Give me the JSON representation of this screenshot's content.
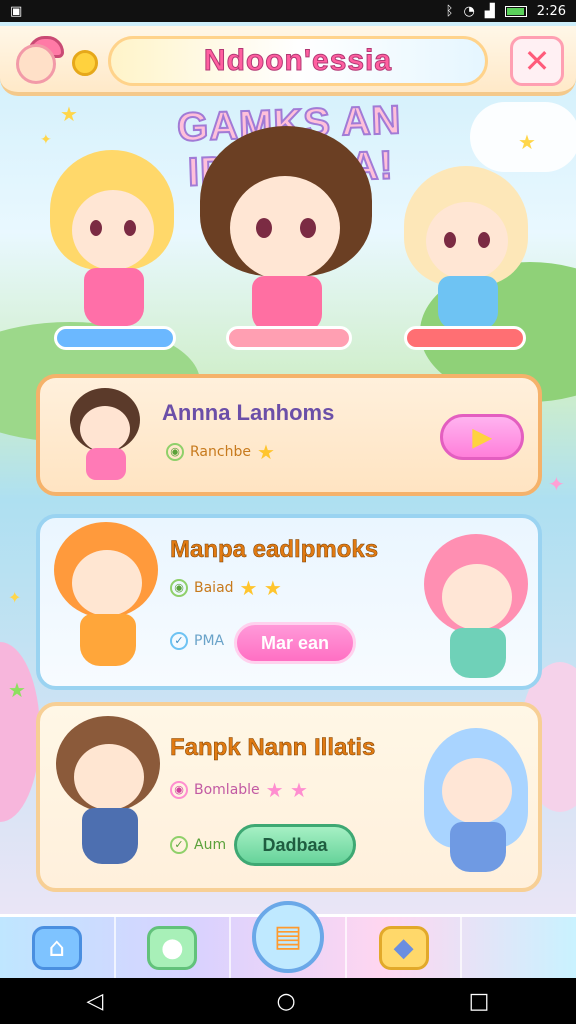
{
  "status_bar": {
    "time": "2:26",
    "icons": [
      "app-icon",
      "bluetooth-icon",
      "signal-icon",
      "wifi-icon",
      "battery-icon"
    ]
  },
  "header": {
    "title": "Ndoon'essia",
    "close_symbol": "✕"
  },
  "banner": {
    "text": "GAMKS AN IDAPRGA!"
  },
  "cards": [
    {
      "title": "Annna Lanhoms",
      "meta1": "Ranchbe",
      "stars": "★",
      "button_symbol": "▶"
    },
    {
      "title": "Manpa eadlpmoks",
      "meta1": "Baiad",
      "stars": "★ ★",
      "meta2": "PMA",
      "button_label": "Mar ean"
    },
    {
      "title": "Fanpk Nann Illatis",
      "meta1": "Bomlable",
      "stars": "★ ★",
      "meta2": "Aum",
      "button_label": "Dadbaa"
    }
  ],
  "bottom_nav": [
    "home-icon",
    "chat-icon",
    "shop-icon",
    "ticket-icon"
  ],
  "android_nav": {
    "back": "◁",
    "home": "○",
    "recents": "□"
  },
  "colors": {
    "accent_pink": "#ff5fa0",
    "accent_orange": "#e07a12",
    "card_border_blue": "#9ad3f1"
  }
}
